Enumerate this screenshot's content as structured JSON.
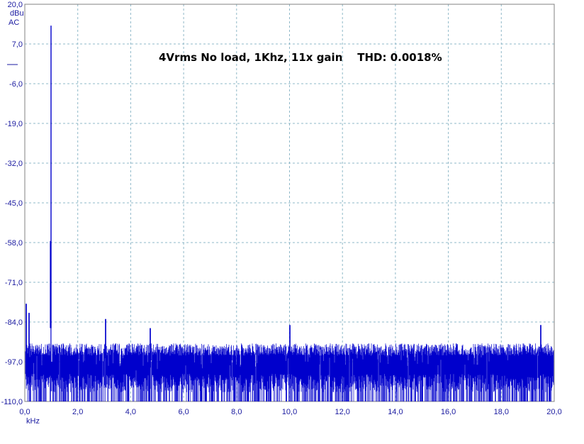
{
  "chart_data": {
    "type": "line",
    "title": "4Vrms No load, 1Khz, 11x gain    THD: 0.0018%",
    "ylabel_unit": "dBu",
    "ylabel_mode": "AC",
    "xlabel": "kHz",
    "xlim": [
      0,
      20
    ],
    "ylim": [
      -110,
      20
    ],
    "x_ticks": [
      "0,0",
      "2,0",
      "4,0",
      "6,0",
      "8,0",
      "10,0",
      "12,0",
      "14,0",
      "16,0",
      "18,0",
      "20,0"
    ],
    "y_ticks": [
      "20,0",
      "7,0",
      "-6,0",
      "-19,0",
      "-32,0",
      "-45,0",
      "-58,0",
      "-71,0",
      "-84,0",
      "-97,0",
      "-110,0"
    ],
    "grid": true,
    "line_color": "#0000cc",
    "series": [
      {
        "values_description_free": true,
        "fundamental_khz": 1.0,
        "fundamental_dbu": 13.0,
        "harmonic2_khz": 1.0,
        "harmonic2_dbu": -57.5,
        "noise_floor_low_dbu": -110,
        "noise_floor_high_dbu": -91,
        "noise_peaks": [
          {
            "x": 0.05,
            "y": -78
          },
          {
            "x": 0.15,
            "y": -81
          },
          {
            "x": 3.05,
            "y": -83
          },
          {
            "x": 4.75,
            "y": -86
          },
          {
            "x": 10.0,
            "y": -85
          },
          {
            "x": 19.5,
            "y": -85
          }
        ]
      }
    ]
  }
}
